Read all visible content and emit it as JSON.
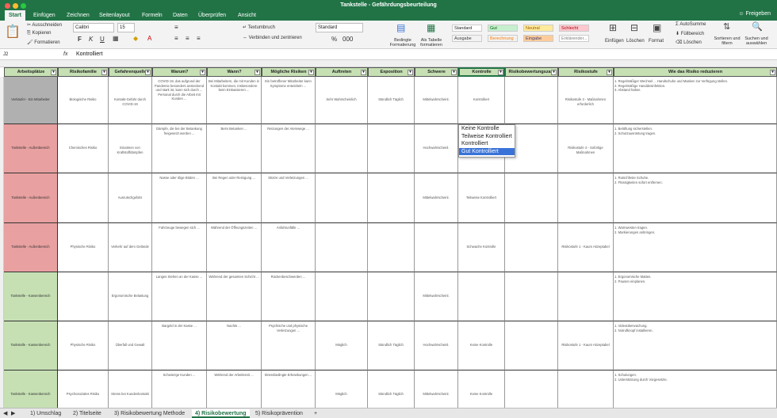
{
  "window": {
    "title": "Tankstelle - Gefährdungsbeurteilung",
    "share_label": "Freigeben"
  },
  "ribbon_tabs": [
    "Start",
    "Einfügen",
    "Zeichnen",
    "Seitenlayout",
    "Formeln",
    "Daten",
    "Überprüfen",
    "Ansicht"
  ],
  "ribbon": {
    "cut": "Ausschneiden",
    "copy": "Kopieren",
    "format_painter": "Formatieren",
    "font": "Calibri",
    "font_size": "15",
    "wrap": "Textumbruch",
    "merge": "Verbinden und zentrieren",
    "number_format": "Standard",
    "cond_format": "Bedingte Formatierung",
    "as_table": "Als Tabelle formatieren",
    "styles": [
      "Standard",
      "Gut",
      "Neutral",
      "Schlecht",
      "Ausgabe",
      "Berechnung",
      "Eingabe",
      "Erklärender..."
    ],
    "insert": "Einfügen",
    "delete": "Löschen",
    "format": "Format",
    "autosum": "AutoSumme",
    "fill": "Füllbereich",
    "clear": "Löschen",
    "sort": "Sortieren und filtern",
    "find": "Suchen und auswählen"
  },
  "formula_bar": {
    "cell_ref": "J2",
    "fx": "fx",
    "value": "Kontrolliert"
  },
  "colors": {
    "accent": "#217346",
    "header_bg": "#c6e0b4",
    "red_row": "#e8a0a0",
    "green_row": "#c6e0b4",
    "gray_row": "#b0b0b0",
    "selection": "#3a73d8"
  },
  "table": {
    "headers": [
      "Arbeitsplätze",
      "Risikofamilie",
      "Gefahrenquelle",
      "Warum?",
      "Wann?",
      "Mögliche Risiken",
      "Auftreten",
      "Exposition",
      "Schwere",
      "Kontrolle",
      "Risikobewertungszahl",
      "Risikostufe",
      "Wie das Risiko reduzieren"
    ],
    "rows": [
      {
        "place": "Verkäufer - Ein Mitarbeiter",
        "family": "Biologische Risiko",
        "source": "Kontakt-Gefahr durch COVID-19",
        "why": "COVID-19, das aufgrund der Pandemie besonders ansteckend und stark ist, kann sich durch ... Personal durch die Arbeit mit Kunden ...",
        "when": "Bei Mitarbeitern, die mit Kunden in Kontakt kommen, insbesondere beim Einkassieren ...",
        "risk": "Ein betroffener Mitarbeiter kann Symptome entwickeln ...",
        "occ": "Sehr Wahrscheinlich",
        "exp": "Stündlich Täglich",
        "sev": "Mittelwahrscheinl.",
        "ctrl": "Kontrolliert",
        "score": "",
        "level": "Risikostufe 3 - Maßnahmen erforderlich",
        "reduce": "1. Regelmäßiger Wechsel ... Handschuhe und Masken zur Verfügung stellen.\n2. Regelmäßige Handdesinfektion.\n3. Abstand halten.",
        "color": "gray"
      },
      {
        "place": "Tankstelle - Außenbereich",
        "family": "Chemisches Risiko",
        "source": "Einatmen von Kraftstoffdämpfen",
        "why": "Dämpfe, die bei der Betankung freigesetzt werden ...",
        "when": "Beim Betanken ...",
        "risk": "Reizungen der Atemwege ...",
        "occ": "",
        "exp": "",
        "sev": "Hochwahrscheinl.",
        "ctrl": "",
        "score": "",
        "level": "Risikostufe 4 - Sofortige Maßnahmen",
        "reduce": "1. Belüftung sicherstellen.\n2. Schutzausrüstung tragen.",
        "color": "red"
      },
      {
        "place": "Tankstelle - Außenbereich",
        "family": "",
        "source": "Ausrutschgefahr",
        "why": "Nasse oder ölige Böden ...",
        "when": "Bei Regen oder Reinigung ...",
        "risk": "Stürze und Verletzungen ...",
        "occ": "",
        "exp": "",
        "sev": "Mittelwahrscheinl.",
        "ctrl": "Teilweise Kontrolliert",
        "score": "",
        "level": "",
        "reduce": "1. Rutschfeste Schuhe.\n2. Flüssigkeiten sofort entfernen.",
        "color": "red"
      },
      {
        "place": "Tankstelle - Außenbereich",
        "family": "Physische Risiko",
        "source": "Verkehr auf dem Gelände",
        "why": "Fahrzeuge bewegen sich ...",
        "when": "Während der Öffnungszeiten ...",
        "risk": "Anfahrunfälle ...",
        "occ": "",
        "exp": "",
        "sev": "",
        "ctrl": "Schwache Kontrolle",
        "score": "",
        "level": "Risikostufe 1 - Kaum Akzeptabel",
        "reduce": "1. Warnwesten tragen.\n2. Markierungen anbringen.",
        "color": "red"
      },
      {
        "place": "Tankstelle - Kassenbereich",
        "family": "",
        "source": "Ergonomische Belastung",
        "why": "Langes Stehen an der Kasse ...",
        "when": "Während der gesamten Schicht ...",
        "risk": "Rückenbeschwerden ...",
        "occ": "",
        "exp": "",
        "sev": "Mittelwahrscheinl.",
        "ctrl": "",
        "score": "",
        "level": "",
        "reduce": "1. Ergonomische Matten.\n2. Pausen einplanen.",
        "color": "green"
      },
      {
        "place": "Tankstelle - Kassenbereich",
        "family": "Physische Risiko",
        "source": "Überfall und Gewalt",
        "why": "Bargeld in der Kasse ...",
        "when": "Nachts ...",
        "risk": "Psychische und physische Verletzungen ...",
        "occ": "Möglich",
        "exp": "Stündlich Täglich",
        "sev": "Hochwahrscheinl.",
        "ctrl": "Keine Kontrolle",
        "score": "",
        "level": "Risikostufe 1 - Kaum Akzeptabel",
        "reduce": "1. Videoüberwachung.\n2. Notrufknopf installieren.",
        "color": "green"
      },
      {
        "place": "Tankstelle - Kassenbereich",
        "family": "Psychosoziales Risiko",
        "source": "Stress bei Kundenkontakt",
        "why": "Schwierige Kunden ...",
        "when": "Während der Arbeitszeit ...",
        "risk": "Stressbedingte Erkrankungen ...",
        "occ": "Möglich",
        "exp": "Stündlich Täglich",
        "sev": "Mittelwahrscheinl.",
        "ctrl": "Keine Kontrolle",
        "score": "",
        "level": "",
        "reduce": "1. Schulungen.\n2. Unterstützung durch Vorgesetzte.",
        "color": "green"
      }
    ]
  },
  "dropdown": {
    "options": [
      "Keine Kontrolle",
      "Teilweise Kontrolliert",
      "Kontrolliert",
      "Gut Kontrolliert"
    ],
    "selected_index": 3
  },
  "sheet_tabs": [
    "1) Umschlag",
    "2) Titelseite",
    "3) Risikobewertung Methode",
    "4) Risikobewertung",
    "5) Risikoprävention"
  ],
  "active_sheet": 3
}
